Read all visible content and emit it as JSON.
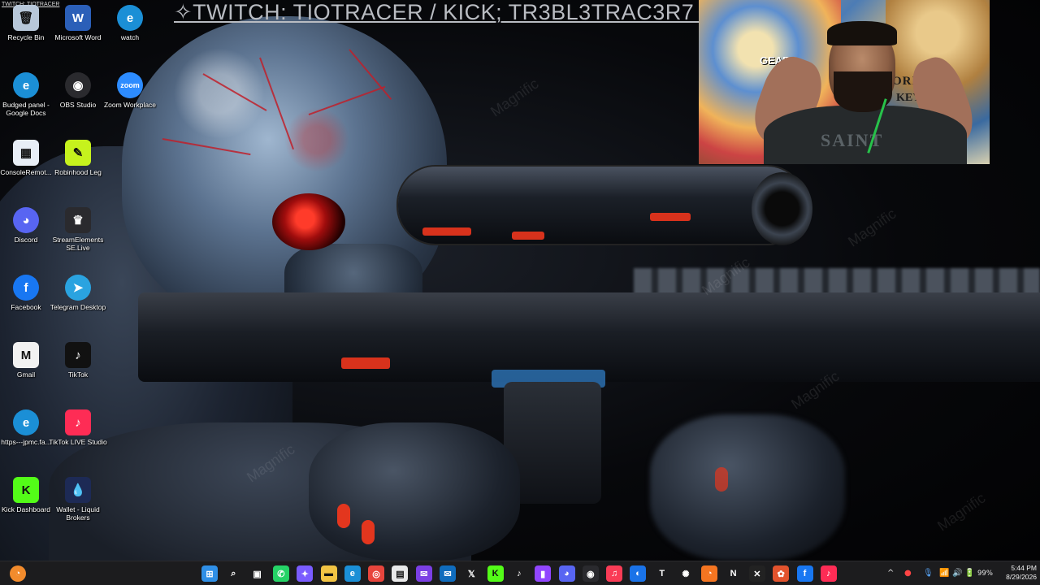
{
  "stream_title": "✧TWITCH: TIOTRACER / KICK; TR3BL3TRAC3R7 ✧",
  "corner_title": "TWITCH: TIOTRACER",
  "watermark": "Magnific",
  "webcam": {
    "poster_gear": "GEAR5",
    "poster_text_1": "ORI",
    "poster_text_2": "KEY·D·LUF",
    "shirt_text": "SAINT"
  },
  "desktop_icons": [
    {
      "label": "Recycle Bin",
      "icon": "recycle-bin-icon",
      "color": "#b7c7d9",
      "glyph": "🗑"
    },
    {
      "label": "Microsoft Word",
      "icon": "word-icon",
      "color": "#2b5fb8",
      "glyph": "W"
    },
    {
      "label": "watch",
      "icon": "edge-icon",
      "color": "#1b8fd6",
      "glyph": "e"
    },
    {
      "label": "Budged panel - Google Docs",
      "icon": "edge-icon",
      "color": "#1b8fd6",
      "glyph": "e"
    },
    {
      "label": "OBS Studio",
      "icon": "obs-icon",
      "color": "#2a2a2e",
      "glyph": "◉"
    },
    {
      "label": "Zoom Workplace",
      "icon": "zoom-icon",
      "color": "#2d8cff",
      "glyph": "zoom"
    },
    {
      "label": "ConsoleRemot...",
      "icon": "console-remote-icon",
      "color": "#e8eef6",
      "glyph": "▦"
    },
    {
      "label": "Robinhood Leg",
      "icon": "robinhood-icon",
      "color": "#c6f21d",
      "glyph": "✎"
    },
    {
      "label": "Discord",
      "icon": "discord-icon",
      "color": "#5865f2",
      "glyph": "◕"
    },
    {
      "label": "StreamElements SE.Live",
      "icon": "streamelements-icon",
      "color": "#2a2a2e",
      "glyph": "♛"
    },
    {
      "label": "Facebook",
      "icon": "facebook-icon",
      "color": "#1877f2",
      "glyph": "f"
    },
    {
      "label": "Telegram Desktop",
      "icon": "telegram-icon",
      "color": "#2aa3e0",
      "glyph": "➤"
    },
    {
      "label": "Gmail",
      "icon": "gmail-icon",
      "color": "#f2f2f2",
      "glyph": "M"
    },
    {
      "label": "TikTok",
      "icon": "tiktok-icon",
      "color": "#111111",
      "glyph": "♪"
    },
    {
      "label": "https---jpmc.fa...",
      "icon": "edge-icon",
      "color": "#1b8fd6",
      "glyph": "e"
    },
    {
      "label": "TikTok LIVE Studio",
      "icon": "tiktok-live-icon",
      "color": "#fe2c55",
      "glyph": "♪"
    },
    {
      "label": "Kick Dashboard",
      "icon": "kick-icon",
      "color": "#53fc18",
      "glyph": "K"
    },
    {
      "label": "Wallet - Liquid Brokers",
      "icon": "wallet-icon",
      "color": "#1d2a55",
      "glyph": "💧"
    }
  ],
  "taskbar": {
    "items": [
      {
        "icon": "start-icon",
        "color": "#2f8fe6",
        "glyph": "⊞"
      },
      {
        "icon": "search-icon",
        "color": "transparent",
        "glyph": "⌕"
      },
      {
        "icon": "task-view-icon",
        "color": "transparent",
        "glyph": "▣"
      },
      {
        "icon": "whatsapp-icon",
        "color": "#25d366",
        "glyph": "✆"
      },
      {
        "icon": "copilot-icon",
        "color": "#7a5cff",
        "glyph": "✦"
      },
      {
        "icon": "file-explorer-icon",
        "color": "#f3c443",
        "glyph": "▬"
      },
      {
        "icon": "edge-icon",
        "color": "#1b8fd6",
        "glyph": "e"
      },
      {
        "icon": "chrome-icon",
        "color": "#e8453c",
        "glyph": "◎"
      },
      {
        "icon": "store-icon",
        "color": "#e9e9e9",
        "glyph": "▤"
      },
      {
        "icon": "mail-icon",
        "color": "#7b3fe4",
        "glyph": "✉"
      },
      {
        "icon": "outlook-icon",
        "color": "#0f6cbd",
        "glyph": "✉"
      },
      {
        "icon": "x-icon",
        "color": "transparent",
        "glyph": "𝕏"
      },
      {
        "icon": "kick-icon",
        "color": "#53fc18",
        "glyph": "K"
      },
      {
        "icon": "tiktok-icon",
        "color": "transparent",
        "glyph": "♪"
      },
      {
        "icon": "twitch-icon",
        "color": "#9146ff",
        "glyph": "▮"
      },
      {
        "icon": "discord-icon",
        "color": "#5865f2",
        "glyph": "◕"
      },
      {
        "icon": "obs-icon",
        "color": "#2a2a2e",
        "glyph": "◉"
      },
      {
        "icon": "music-icon",
        "color": "#fa3c56",
        "glyph": "♫"
      },
      {
        "icon": "chrome-alt-icon",
        "color": "#1a73e8",
        "glyph": "◐"
      },
      {
        "icon": "tidal-icon",
        "color": "transparent",
        "glyph": "T"
      },
      {
        "icon": "chatgpt-icon",
        "color": "transparent",
        "glyph": "✺"
      },
      {
        "icon": "crunchyroll-icon",
        "color": "#f47521",
        "glyph": "◔"
      },
      {
        "icon": "netflix-icon",
        "color": "transparent",
        "glyph": "N"
      },
      {
        "icon": "capcut-icon",
        "color": "#222",
        "glyph": "✕"
      },
      {
        "icon": "photos-icon",
        "color": "#e2532d",
        "glyph": "✿"
      },
      {
        "icon": "facebook-icon",
        "color": "#1877f2",
        "glyph": "f"
      },
      {
        "icon": "tiktok-live-icon",
        "color": "#fe2c55",
        "glyph": "♪"
      }
    ],
    "tray": {
      "overflow": "^",
      "battery": "99%",
      "time": "5:44 PM",
      "date": "8/29/2026"
    }
  }
}
